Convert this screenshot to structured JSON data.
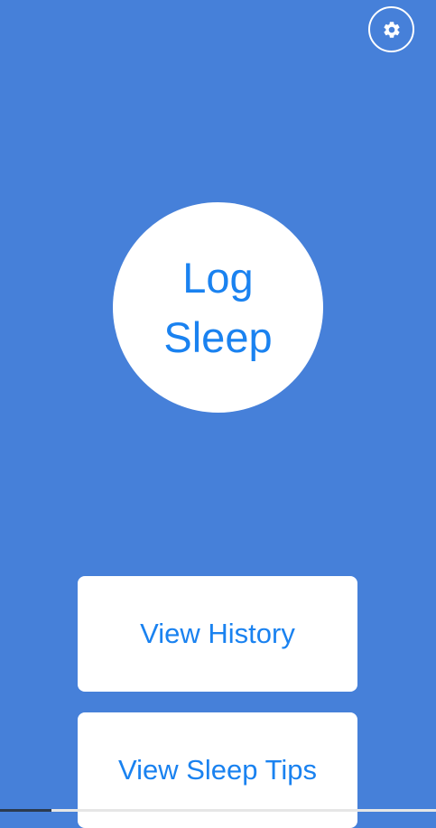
{
  "colors": {
    "background": "#4680d9",
    "button_background": "#ffffff",
    "button_text": "#1a82f0"
  },
  "header": {
    "settings_icon": "gear-icon"
  },
  "main": {
    "log_sleep_label": "Log Sleep"
  },
  "actions": {
    "view_history_label": "View History",
    "view_sleep_tips_label": "View Sleep Tips"
  }
}
